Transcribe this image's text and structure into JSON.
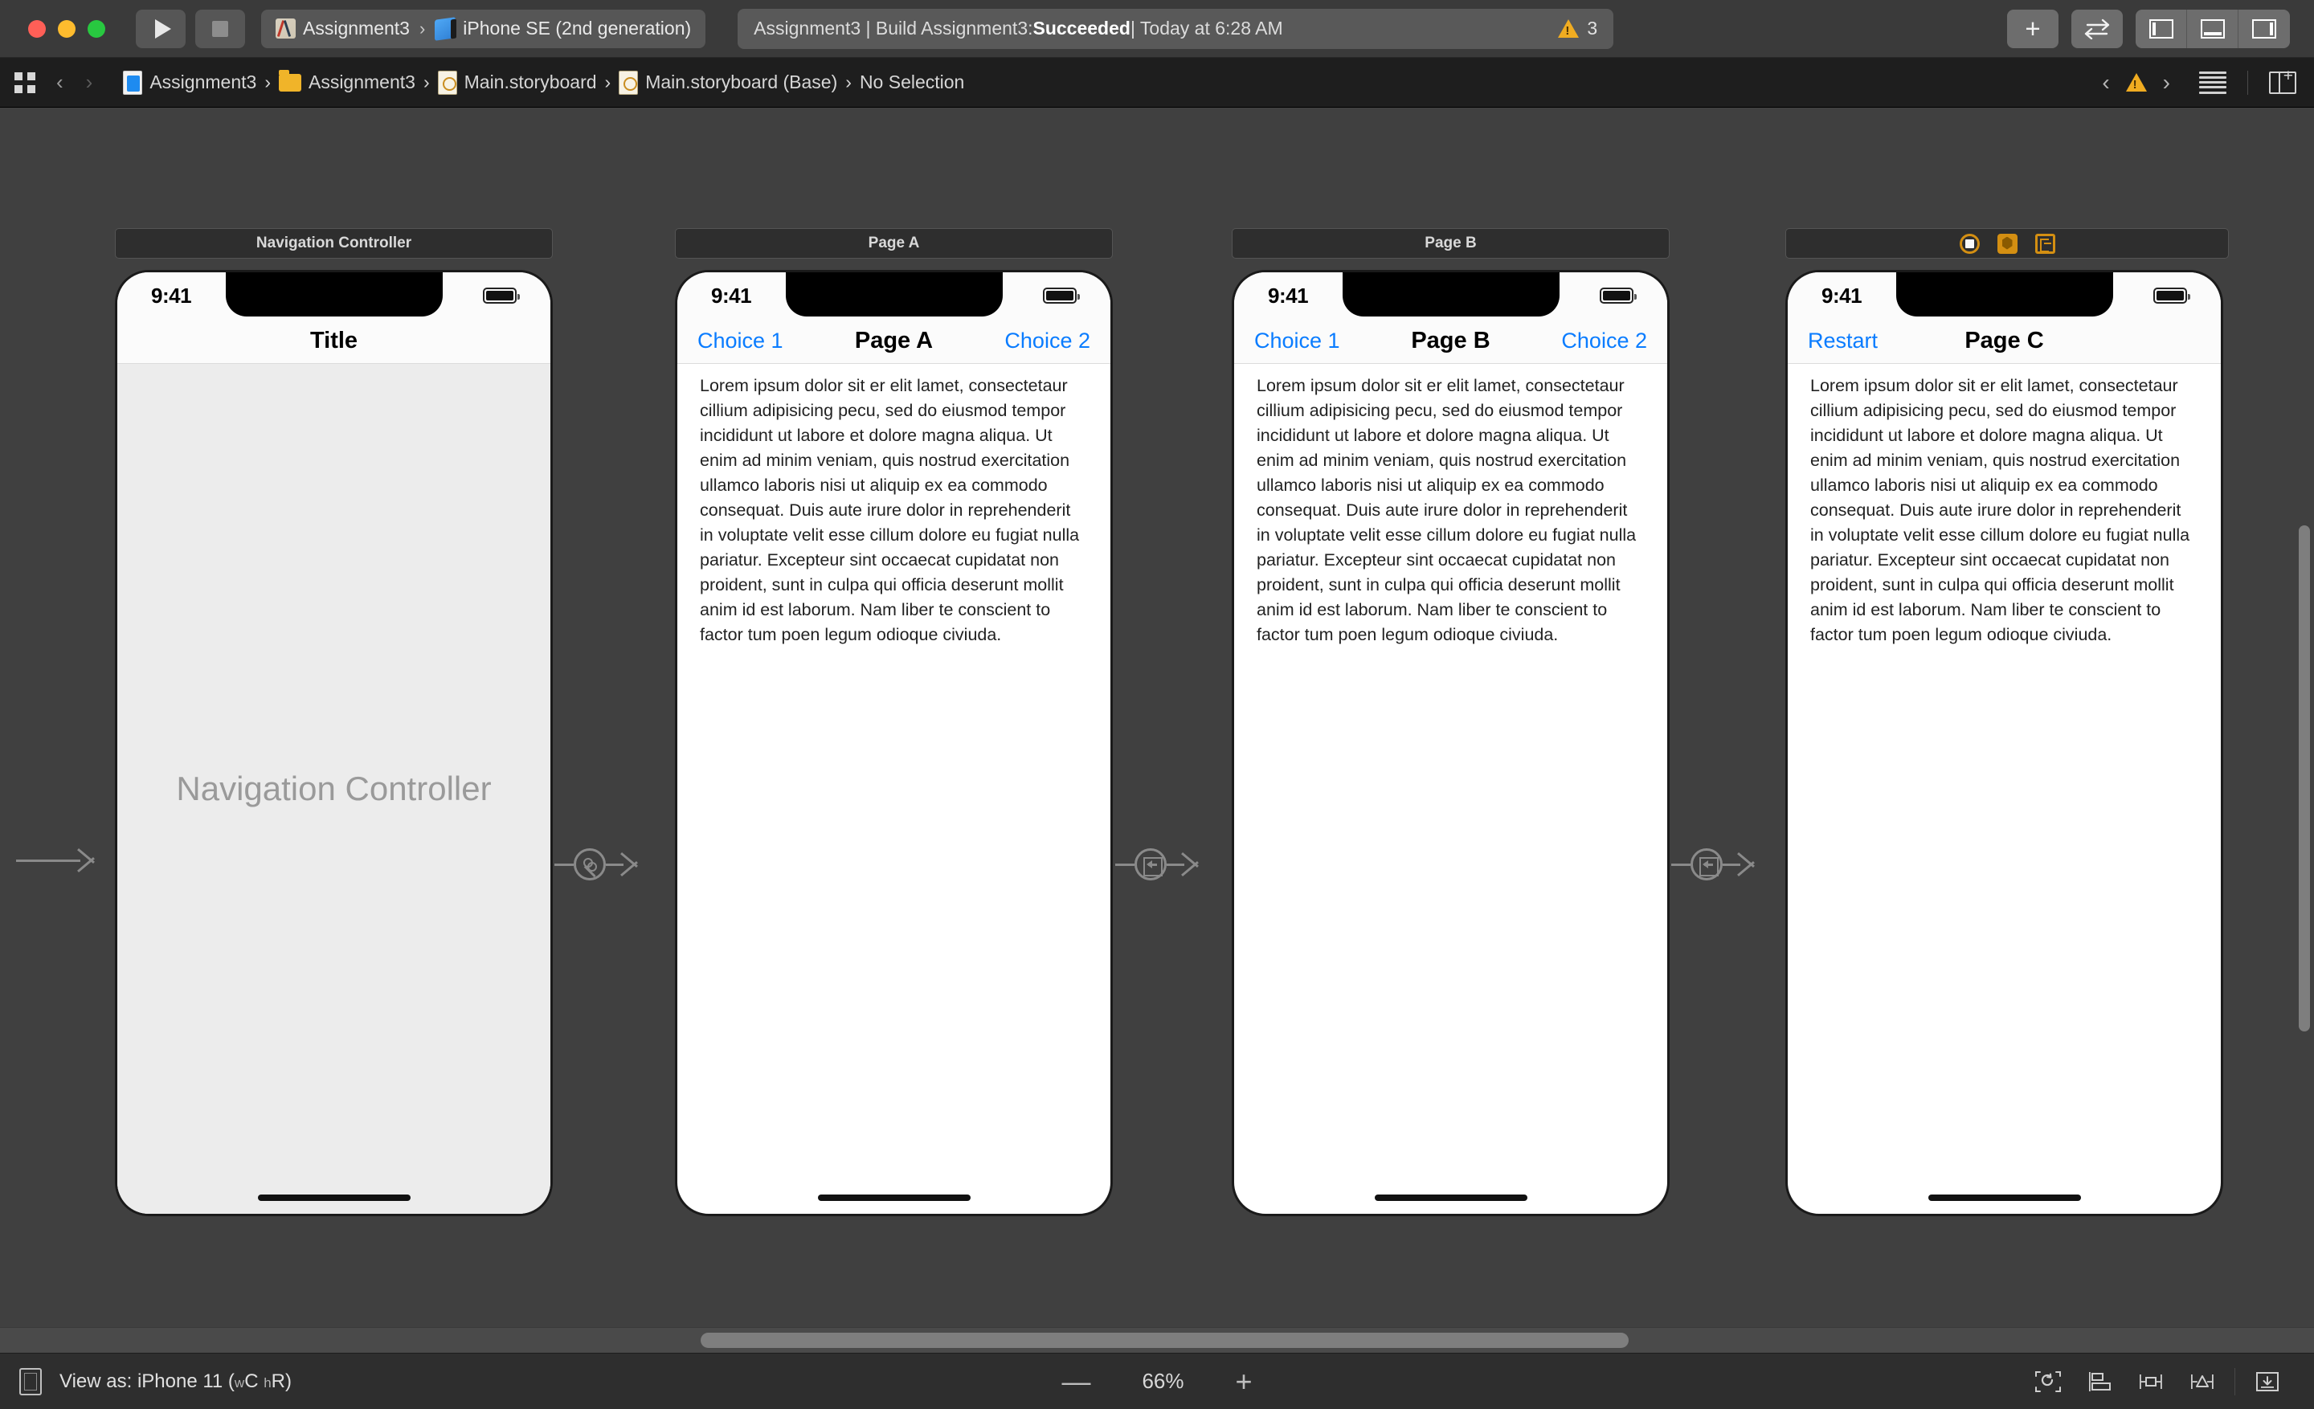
{
  "window": {
    "traffic_lights": [
      "close",
      "minimize",
      "zoom"
    ],
    "run_button": "run",
    "stop_button": "stop"
  },
  "toolbar": {
    "scheme_project": "Assignment3",
    "scheme_separator": "›",
    "scheme_destination": "iPhone SE (2nd generation)",
    "status_prefix": "Assignment3 | Build Assignment3: ",
    "status_result": "Succeeded",
    "status_suffix": " | Today at 6:28 AM",
    "warning_count": "3",
    "add_button": "+",
    "swap_button": "⇄",
    "panel_left": "left-panel",
    "panel_bottom": "bottom-panel",
    "panel_right": "right-panel"
  },
  "breadcrumb": {
    "back": "‹",
    "forward": "›",
    "separator": "›",
    "items": [
      {
        "label": "Assignment3",
        "icon": "swift-project-icon"
      },
      {
        "label": "Assignment3",
        "icon": "folder-icon"
      },
      {
        "label": "Main.storyboard",
        "icon": "storyboard-icon"
      },
      {
        "label": "Main.storyboard (Base)",
        "icon": "storyboard-icon"
      },
      {
        "label": "No Selection",
        "icon": "none"
      }
    ],
    "issue_prev": "‹",
    "issue_next": "›",
    "issue_badge": "warning-triangle"
  },
  "canvas": {
    "scenes": [
      {
        "label": "Navigation Controller",
        "label_icons": [],
        "status_time": "9:41",
        "nav_left": "",
        "nav_title": "Title",
        "nav_right": "",
        "placeholder": "Navigation Controller",
        "body": ""
      },
      {
        "label": "Page A",
        "label_icons": [],
        "status_time": "9:41",
        "nav_left": "Choice 1",
        "nav_title": "Page A",
        "nav_right": "Choice 2",
        "placeholder": "",
        "body": "Lorem ipsum dolor sit er elit lamet, consectetaur cillium adipisicing pecu, sed do eiusmod tempor incididunt ut labore et dolore magna aliqua. Ut enim ad minim veniam, quis nostrud exercitation ullamco laboris nisi ut aliquip ex ea commodo consequat. Duis aute irure dolor in reprehenderit in voluptate velit esse cillum dolore eu fugiat nulla pariatur. Excepteur sint occaecat cupidatat non proident, sunt in culpa qui officia deserunt mollit anim id est laborum. Nam liber te conscient to factor tum poen legum odioque civiuda."
      },
      {
        "label": "Page B",
        "label_icons": [],
        "status_time": "9:41",
        "nav_left": "Choice 1",
        "nav_title": "Page B",
        "nav_right": "Choice 2",
        "placeholder": "",
        "body": "Lorem ipsum dolor sit er elit lamet, consectetaur cillium adipisicing pecu, sed do eiusmod tempor incididunt ut labore et dolore magna aliqua. Ut enim ad minim veniam, quis nostrud exercitation ullamco laboris nisi ut aliquip ex ea commodo consequat. Duis aute irure dolor in reprehenderit in voluptate velit esse cillum dolore eu fugiat nulla pariatur. Excepteur sint occaecat cupidatat non proident, sunt in culpa qui officia deserunt mollit anim id est laborum. Nam liber te conscient to factor tum poen legum odioque civiuda."
      },
      {
        "label": "",
        "label_icons": [
          "view-controller-icon",
          "first-responder-icon",
          "exit-icon"
        ],
        "status_time": "9:41",
        "nav_left": "Restart",
        "nav_title": "Page C",
        "nav_right": "",
        "placeholder": "",
        "body": "Lorem ipsum dolor sit er elit lamet, consectetaur cillium adipisicing pecu, sed do eiusmod tempor incididunt ut labore et dolore magna aliqua. Ut enim ad minim veniam, quis nostrud exercitation ullamco laboris nisi ut aliquip ex ea commodo consequat. Duis aute irure dolor in reprehenderit in voluptate velit esse cillum dolore eu fugiat nulla pariatur. Excepteur sint occaecat cupidatat non proident, sunt in culpa qui officia deserunt mollit anim id est laborum. Nam liber te conscient to factor tum poen legum odioque civiuda."
      }
    ],
    "segues": [
      {
        "kind": "entry-point-arrow"
      },
      {
        "kind": "relationship-segue"
      },
      {
        "kind": "show-segue"
      },
      {
        "kind": "show-segue"
      }
    ]
  },
  "bottombar": {
    "view_as_label": "View as: iPhone 11 (",
    "view_as_w": "w",
    "view_as_wc": "C ",
    "view_as_h": "h",
    "view_as_hr": "R)",
    "zoom_out": "—",
    "zoom_level": "66%",
    "zoom_in": "+",
    "tools": [
      "update-frames-icon",
      "align-icon",
      "add-constraints-icon",
      "resolve-issues-icon",
      "embed-in-icon"
    ]
  },
  "colors": {
    "accent_blue": "#0a7cff",
    "warning_orange": "#f0ac21",
    "scene_icon_orange": "#d48f12",
    "canvas_bg": "#404040",
    "chrome_bg": "#3a3a3a"
  }
}
